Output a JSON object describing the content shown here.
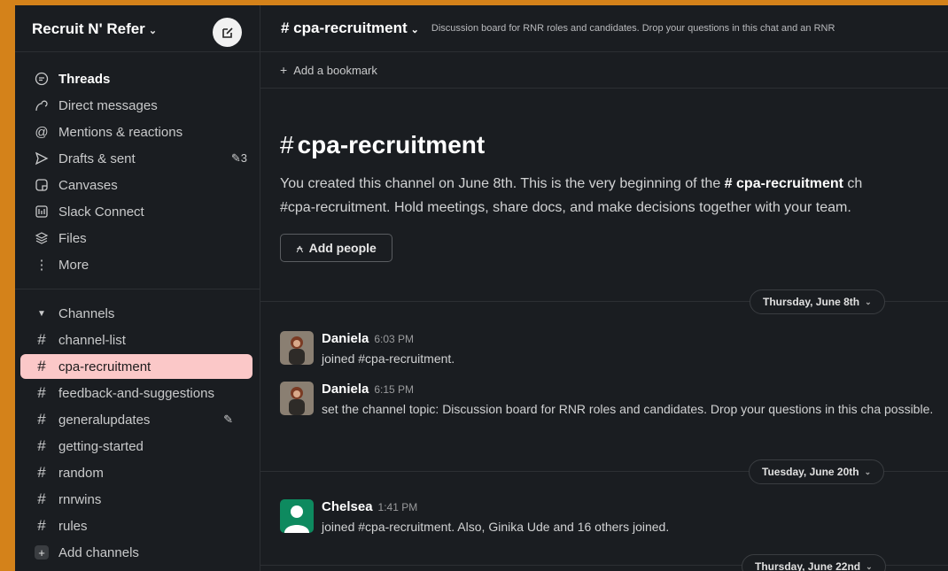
{
  "workspace": {
    "name": "Recruit N' Refer",
    "chevron": "⌄"
  },
  "nav": [
    {
      "label": "Threads",
      "icon": "threads-icon",
      "bold": true
    },
    {
      "label": "Direct messages",
      "icon": "dm-icon"
    },
    {
      "label": "Mentions & reactions",
      "icon": "at-icon"
    },
    {
      "label": "Drafts & sent",
      "icon": "send-icon",
      "badge": "3"
    },
    {
      "label": "Canvases",
      "icon": "canvas-icon"
    },
    {
      "label": "Slack Connect",
      "icon": "slack-connect-icon"
    },
    {
      "label": "Files",
      "icon": "files-icon"
    },
    {
      "label": "More",
      "icon": "more-icon"
    }
  ],
  "channels_header": "Channels",
  "channels": [
    {
      "name": "channel-list"
    },
    {
      "name": "cpa-recruitment",
      "active": true
    },
    {
      "name": "feedback-and-suggestions"
    },
    {
      "name": "generalupdates",
      "edit": true
    },
    {
      "name": "getting-started"
    },
    {
      "name": "random"
    },
    {
      "name": "rnrwins"
    },
    {
      "name": "rules"
    }
  ],
  "add_channels": "Add channels",
  "header": {
    "channel": "# cpa-recruitment",
    "topic": "Discussion board for RNR roles and candidates. Drop your questions in this chat and an RNR"
  },
  "bookmark": {
    "label": "Add a bookmark"
  },
  "intro": {
    "title_hash": "#",
    "title": "cpa-recruitment",
    "line1_pre": "You created this channel on June 8th. This is the very beginning of the ",
    "line1_bold": "# cpa-recruitment",
    "line1_post": " ch",
    "line2": "#cpa-recruitment. Hold meetings, share docs, and make decisions together with your team.",
    "add_people": "Add people"
  },
  "dates": [
    "Thursday, June 8th",
    "Tuesday, June 20th",
    "Thursday, June 22nd"
  ],
  "messages": [
    {
      "name": "Daniela",
      "time": "6:03 PM",
      "text": "joined #cpa-recruitment."
    },
    {
      "name": "Daniela",
      "time": "6:15 PM",
      "text": "set the channel topic: Discussion board for RNR roles and candidates. Drop your questions in this cha possible."
    },
    {
      "name": "Chelsea",
      "time": "1:41 PM",
      "text": "joined #cpa-recruitment. Also, Ginika Ude and 16 others joined."
    }
  ],
  "colors": {
    "sidebar_bg": "#1a1d21",
    "active_channel": "#fbc8c8",
    "frame": "#d4821a",
    "avatar_green": "#0e8a5f"
  }
}
